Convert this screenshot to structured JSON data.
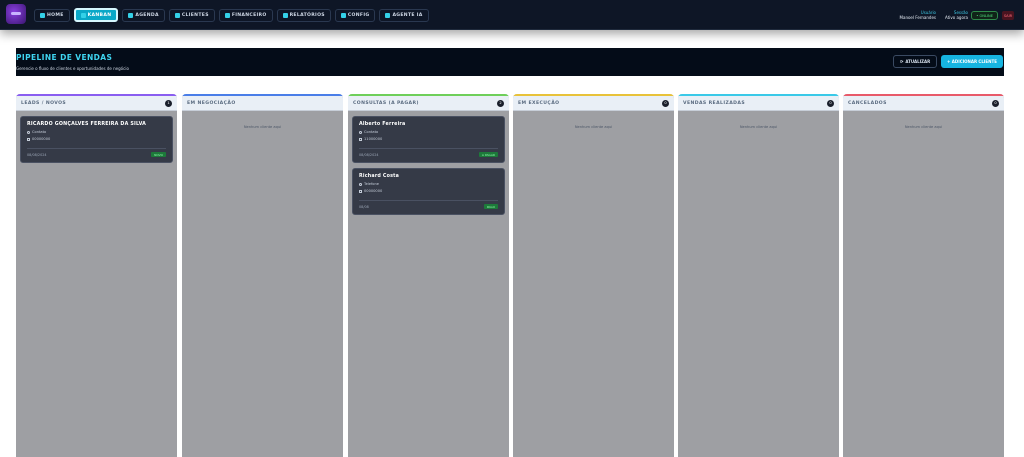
{
  "nav": {
    "items": [
      {
        "label": "HOME",
        "active": false
      },
      {
        "label": "KANBAN",
        "active": true
      },
      {
        "label": "AGENDA",
        "active": false
      },
      {
        "label": "CLIENTES",
        "active": false
      },
      {
        "label": "FINANCEIRO",
        "active": false
      },
      {
        "label": "RELATÓRIOS",
        "active": false
      },
      {
        "label": "CONFIG",
        "active": false
      },
      {
        "label": "AGENTE IA",
        "active": false
      }
    ]
  },
  "user": {
    "label": "Usuário",
    "name": "Manoel Fernandes"
  },
  "session": {
    "label": "Sessão",
    "value": "Ativo agora"
  },
  "status": {
    "online": "• ONLINE"
  },
  "exit_label": "SAIR",
  "header": {
    "title": "PIPELINE DE VENDAS",
    "subtitle": "Gerencie o fluxo de clientes e oportunidades de negócio",
    "refresh_label": "ATUALIZAR",
    "add_label": "+ ADICIONAR CLIENTE"
  },
  "columns": [
    {
      "title": "LEADS / NOVOS",
      "count": "1",
      "empty": "",
      "accent": "#8a5ef0",
      "cards": [
        {
          "name": "RICARDO GONÇALVES FERREIRA DA SILVA",
          "contact": "Contato",
          "phone": "00000000",
          "date": "08/08/2024",
          "tag": "NOVO"
        }
      ]
    },
    {
      "title": "EM NEGOCIAÇÃO",
      "count": "0",
      "empty": "Nenhum cliente aqui",
      "accent": "#4a7ee8",
      "cards": []
    },
    {
      "title": "CONSULTAS (A PAGAR)",
      "count": "2",
      "empty": "",
      "accent": "#6fcf5a",
      "cards": [
        {
          "name": "Alberto Ferreira",
          "contact": "Contato",
          "phone": "11000000",
          "date": "08/08/2024",
          "tag": "A PAGAR"
        },
        {
          "name": "Richard Costa",
          "contact": "Telefone",
          "phone": "00000000",
          "date": "08/08",
          "tag": "PAGO"
        }
      ]
    },
    {
      "title": "EM EXECUÇÃO",
      "count": "0",
      "empty": "Nenhum cliente aqui",
      "accent": "#e8c23a",
      "cards": []
    },
    {
      "title": "VENDAS REALIZADAS",
      "count": "0",
      "empty": "Nenhum cliente aqui",
      "accent": "#3ac9e8",
      "cards": []
    },
    {
      "title": "CANCELADOS",
      "count": "0",
      "empty": "Nenhum cliente aqui",
      "accent": "#e85a6a",
      "cards": []
    }
  ]
}
